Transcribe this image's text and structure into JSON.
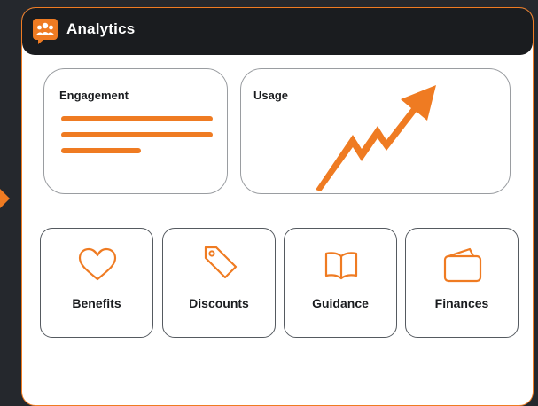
{
  "app": {
    "title": "Analytics",
    "logo_icon": "group-chat-icon",
    "accent_color": "#ef7b22",
    "header_color": "#1a1c1f"
  },
  "cards": {
    "engagement": {
      "title": "Engagement",
      "icon": "text-lines-icon"
    },
    "usage": {
      "title": "Usage",
      "icon": "trend-up-arrow-icon"
    }
  },
  "tiles": [
    {
      "label": "Benefits",
      "icon": "heart-icon"
    },
    {
      "label": "Discounts",
      "icon": "price-tag-icon"
    },
    {
      "label": "Guidance",
      "icon": "open-book-icon"
    },
    {
      "label": "Finances",
      "icon": "wallet-icon"
    }
  ]
}
